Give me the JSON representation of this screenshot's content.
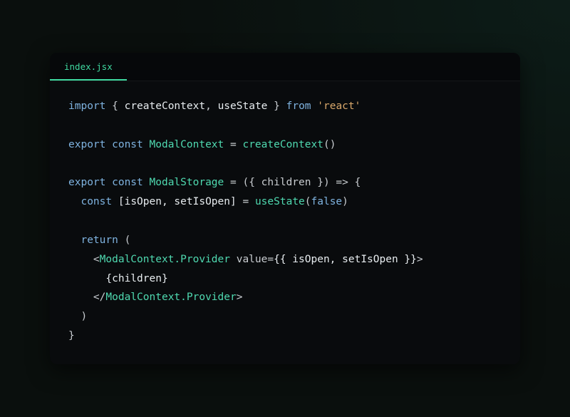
{
  "tab": {
    "label": "index.jsx"
  },
  "code": {
    "l1_import": "import",
    "l1_brace_open": " { ",
    "l1_id1": "createContext",
    "l1_comma": ", ",
    "l1_id2": "useState",
    "l1_brace_close": " } ",
    "l1_from": "from",
    "l1_sp": " ",
    "l1_str": "'react'",
    "l3_export": "export",
    "l3_const": " const ",
    "l3_name": "ModalContext",
    "l3_eq": " = ",
    "l3_call": "createContext",
    "l3_paren": "()",
    "l5_export": "export",
    "l5_const": " const ",
    "l5_name": "ModalStorage",
    "l5_eq": " = ",
    "l5_args": "({ children }) => {",
    "l6_indent": "  ",
    "l6_const": "const",
    "l6_sp": " ",
    "l6_destr": "[isOpen, setIsOpen]",
    "l6_eq": " = ",
    "l6_call": "useState",
    "l6_open": "(",
    "l6_false": "false",
    "l6_close": ")",
    "l8_indent": "  ",
    "l8_return": "return",
    "l8_paren": " (",
    "l9_indent": "    ",
    "l9_open": "<",
    "l9_comp": "ModalContext.Provider",
    "l9_sp": " ",
    "l9_attr": "value",
    "l9_eq": "=",
    "l9_val": "{{ isOpen, setIsOpen }}",
    "l9_close": ">",
    "l10_indent": "      ",
    "l10_children": "{children}",
    "l11_indent": "    ",
    "l11_open": "</",
    "l11_comp": "ModalContext.Provider",
    "l11_close": ">",
    "l12_indent": "  ",
    "l12_paren": ")",
    "l13_brace": "}"
  }
}
